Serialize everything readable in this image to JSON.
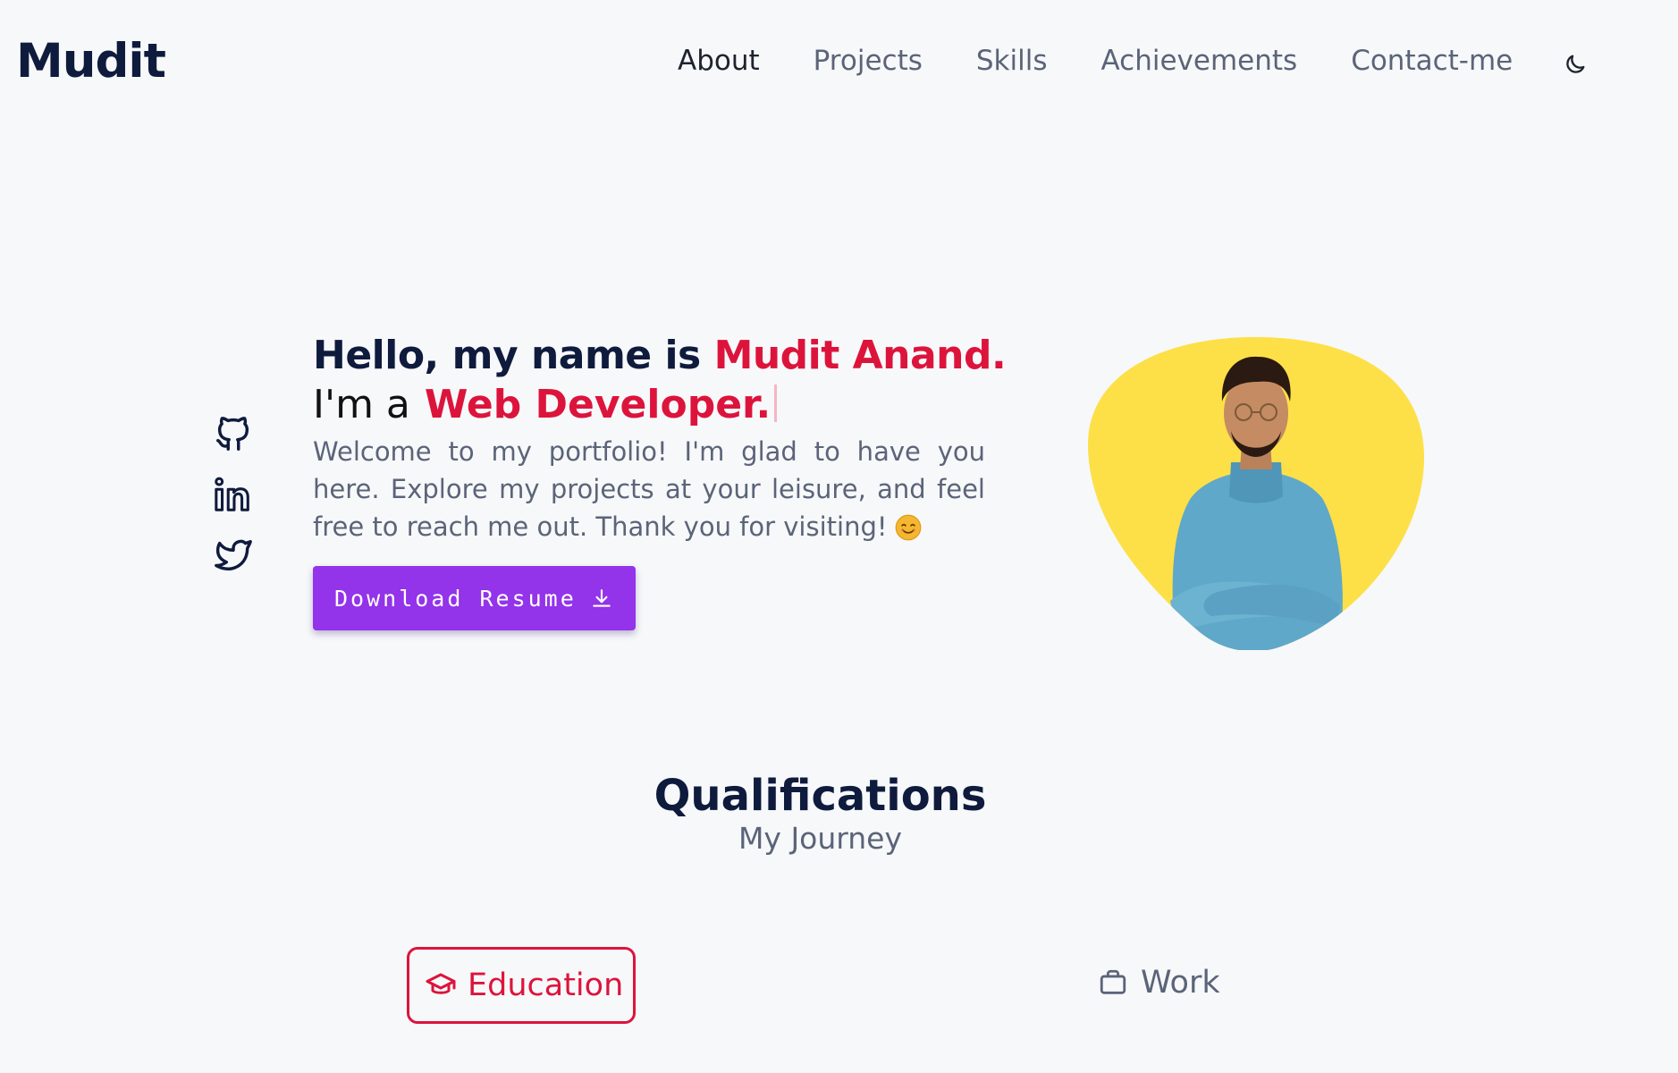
{
  "header": {
    "logo": "Mudit",
    "nav": [
      "About",
      "Projects",
      "Skills",
      "Achievements",
      "Contact-me"
    ],
    "theme_toggle_icon": "moon-icon"
  },
  "hero": {
    "greeting_prefix": "Hello, my name is ",
    "name": "Mudit Anand.",
    "role_prefix": "I'm a",
    "role": "Web Developer.",
    "welcome": "Welcome to my portfolio! I'm glad to have you here. Explore my projects at your leisure, and feel free to reach me out. Thank you for visiting!",
    "resume_button": "Download Resume",
    "socials": [
      "github-icon",
      "linkedin-icon",
      "twitter-icon"
    ],
    "accent_color": "#dc143c",
    "button_color": "#9333ea",
    "blob_color": "#fde047"
  },
  "qualifications": {
    "title": "Qualifications",
    "subtitle": "My Journey",
    "tabs": {
      "education": "Education",
      "work": "Work"
    }
  }
}
